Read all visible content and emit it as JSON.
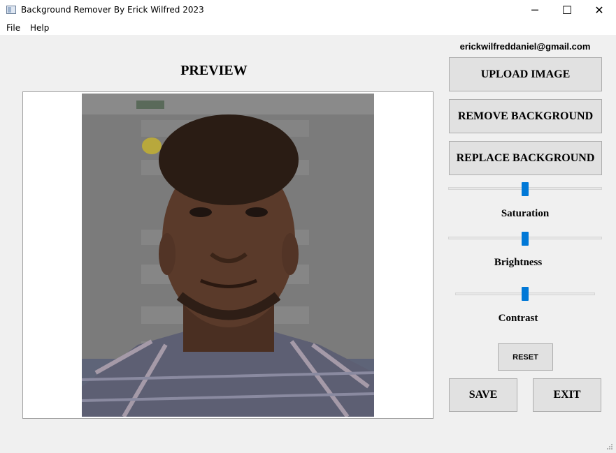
{
  "window": {
    "title": "Background Remover By Erick Wilfred 2023",
    "minimize_glyph": "─",
    "maximize_glyph": "☐",
    "close_glyph": "✕"
  },
  "menu": {
    "items": [
      "File",
      "Help"
    ]
  },
  "header": {
    "email": "erickwilfreddaniel@gmail.com"
  },
  "preview": {
    "title": "PREVIEW"
  },
  "buttons": {
    "upload": "UPLOAD IMAGE",
    "remove": "REMOVE BACKGROUND",
    "replace": "REPLACE BACKGROUND",
    "reset": "RESET",
    "save": "SAVE",
    "exit": "EXIT"
  },
  "sliders": {
    "saturation": {
      "label": "Saturation",
      "level": 0.5
    },
    "brightness": {
      "label": "Brightness",
      "level": 0.5
    },
    "contrast": {
      "label": "Contrast",
      "level": 0.5
    }
  },
  "colors": {
    "slider_accent": "#0078d7",
    "button_bg": "#e1e1e1"
  }
}
